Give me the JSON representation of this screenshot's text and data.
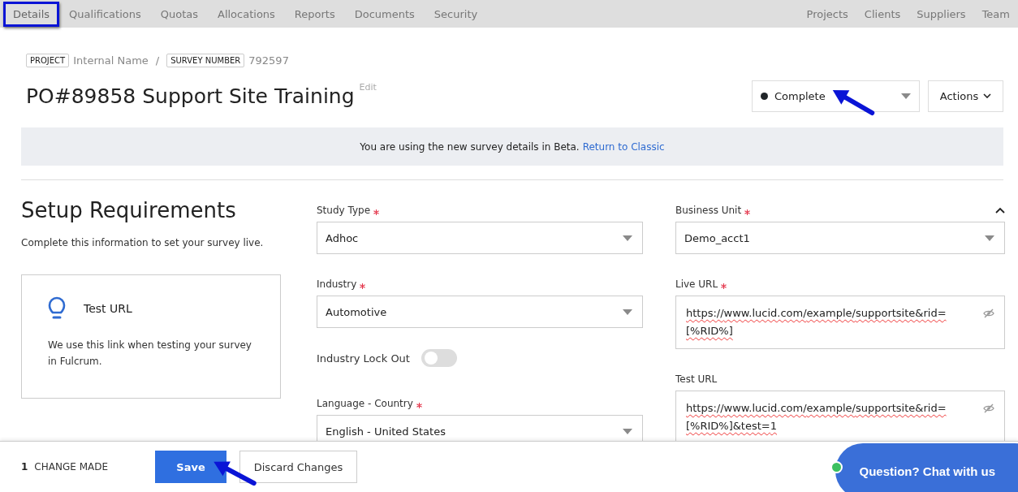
{
  "nav": {
    "left": [
      {
        "label": "Details",
        "selected": true
      },
      {
        "label": "Qualifications",
        "selected": false
      },
      {
        "label": "Quotas",
        "selected": false
      },
      {
        "label": "Allocations",
        "selected": false
      },
      {
        "label": "Reports",
        "selected": false
      },
      {
        "label": "Documents",
        "selected": false
      },
      {
        "label": "Security",
        "selected": false
      }
    ],
    "right": [
      "Projects",
      "Clients",
      "Suppliers",
      "Team"
    ]
  },
  "breadcrumb": [
    {
      "tag": "PROJECT",
      "value": "Internal Name"
    },
    {
      "separator": "/"
    },
    {
      "tag": "SURVEY NUMBER",
      "value": "792597"
    }
  ],
  "title": "PO#89858 Support Site Training",
  "title_edit": "Edit",
  "status": {
    "value": "Complete",
    "color": "#212529"
  },
  "actions": "Actions",
  "banner": {
    "text": "You are using the new survey details in Beta.",
    "link": "Return to Classic"
  },
  "setup": {
    "heading": "Setup Requirements",
    "subtitle": "Complete this information to set your survey live.",
    "tip": {
      "title": "Test URL",
      "text": "We use this link when testing your survey in Fulcrum."
    }
  },
  "middle_fields": [
    {
      "kind": "select",
      "label": "Study Type",
      "required": true,
      "value": "Adhoc"
    },
    {
      "kind": "select",
      "label": "Industry",
      "required": true,
      "value": "Automotive"
    },
    {
      "kind": "toggle",
      "label": "Industry Lock Out",
      "on": false
    },
    {
      "kind": "select",
      "label": "Language - Country",
      "required": true,
      "value": "English - United States"
    }
  ],
  "right_fields": [
    {
      "kind": "select",
      "label": "Business Unit",
      "required": true,
      "value": "Demo_acct1"
    },
    {
      "kind": "url",
      "label": "Live URL",
      "required": true,
      "value": "https://www.lucid.com/example/supportsite&rid=[%RID%]"
    },
    {
      "kind": "url",
      "label": "Test URL",
      "required": false,
      "value": "https://www.lucid.com/example/supportsite&rid=[%RID%]&test=1"
    }
  ],
  "footer": {
    "count": "1",
    "count_label": "CHANGE MADE",
    "buttons": [
      {
        "label": "Save",
        "kind": "primary"
      },
      {
        "label": "Discard Changes",
        "kind": "secondary"
      }
    ]
  },
  "chat": {
    "label": "Question? Chat with us",
    "online": true
  }
}
